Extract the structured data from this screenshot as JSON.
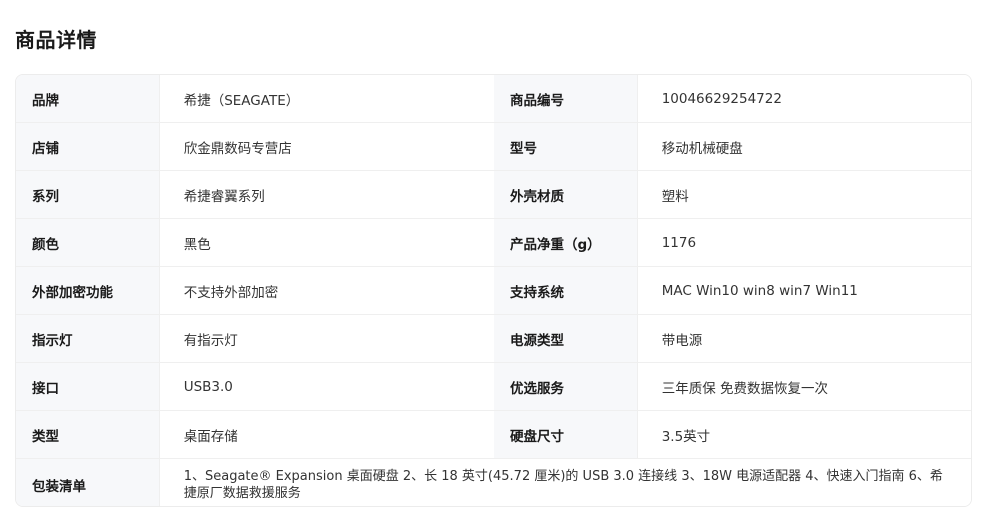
{
  "page_title": "商品详情",
  "rows": [
    {
      "k1": "品牌",
      "v1": "希捷（SEAGATE）",
      "k2": "商品编号",
      "v2": "10046629254722"
    },
    {
      "k1": "店铺",
      "v1": "欣金鼎数码专营店",
      "k2": "型号",
      "v2": "移动机械硬盘"
    },
    {
      "k1": "系列",
      "v1": "希捷睿翼系列",
      "k2": "外壳材质",
      "v2": "塑料"
    },
    {
      "k1": "颜色",
      "v1": "黑色",
      "k2": "产品净重（g）",
      "v2": "1176"
    },
    {
      "k1": "外部加密功能",
      "v1": "不支持外部加密",
      "k2": "支持系统",
      "v2": "MAC Win10 win8 win7 Win11"
    },
    {
      "k1": "指示灯",
      "v1": "有指示灯",
      "k2": "电源类型",
      "v2": "带电源"
    },
    {
      "k1": "接口",
      "v1": "USB3.0",
      "k2": "优选服务",
      "v2": "三年质保 免费数据恢复一次"
    },
    {
      "k1": "类型",
      "v1": "桌面存储",
      "k2": "硬盘尺寸",
      "v2": "3.5英寸"
    }
  ],
  "package": {
    "label": "包装清单",
    "value": "1、Seagate® Expansion 桌面硬盘 2、长 18 英寸(45.72 厘米)的 USB 3.0 连接线 3、18W 电源适配器 4、快速入门指南 6、希捷原厂数据救援服务"
  }
}
